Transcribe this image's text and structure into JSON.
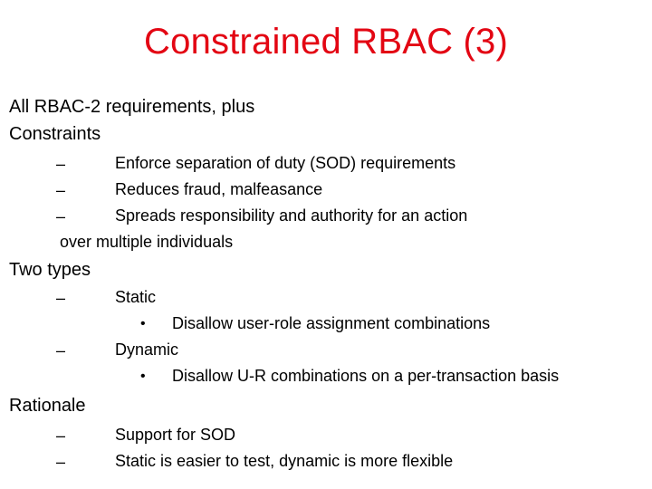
{
  "slide": {
    "title": "Constrained RBAC (3)",
    "title_color": "#e30613",
    "intro": {
      "line1": "All RBAC-2 requirements, plus",
      "line2": "Constraints"
    },
    "constraints": {
      "dash": "–",
      "items": [
        "Enforce separation of duty (SOD) requirements",
        "Reduces fraud, malfeasance",
        "Spreads responsibility and authority for an action"
      ],
      "continuation": "over multiple individuals"
    },
    "two_types": {
      "heading": "Two types",
      "dash": "–",
      "bullet": "•",
      "items": [
        {
          "label": "Static",
          "sub": "Disallow user-role assignment combinations"
        },
        {
          "label": "Dynamic",
          "sub": "Disallow U-R combinations on a per-transaction basis"
        }
      ]
    },
    "rationale": {
      "heading": "Rationale",
      "dash": "–",
      "items": [
        "Support for SOD",
        "Static is easier to test, dynamic is more flexible"
      ]
    }
  }
}
